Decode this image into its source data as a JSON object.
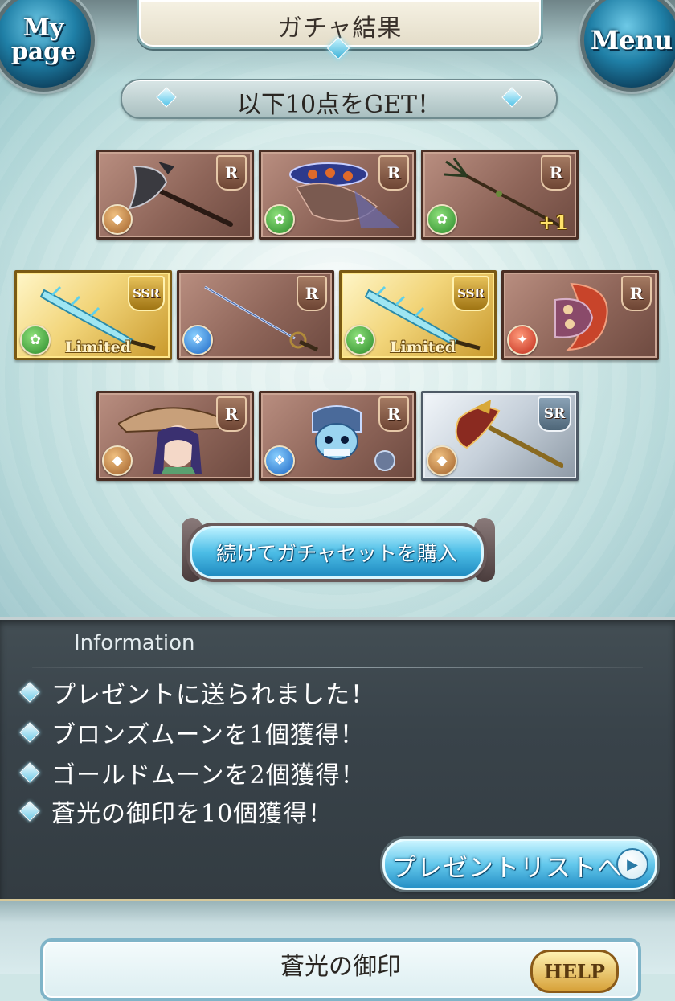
{
  "header": {
    "title": "ガチャ結果",
    "mypage_label": "My\npage",
    "menu_label": "Menu"
  },
  "result_banner": "以下10点をGET！",
  "cards": [
    {
      "rarity": "R",
      "element": "earth",
      "element_icon": "earth-element-icon",
      "art": "axe-weapon",
      "plus": "",
      "limited": ""
    },
    {
      "rarity": "R",
      "element": "wind",
      "element_icon": "wind-element-icon",
      "art": "insect-monster-summon",
      "plus": "",
      "limited": ""
    },
    {
      "rarity": "R",
      "element": "wind",
      "element_icon": "wind-element-icon",
      "art": "trident-spear-weapon",
      "plus": "+1",
      "limited": ""
    },
    {
      "rarity": "SSR",
      "element": "wind",
      "element_icon": "wind-element-icon",
      "art": "crystal-sword-weapon",
      "plus": "",
      "limited": "Limited"
    },
    {
      "rarity": "R",
      "element": "water",
      "element_icon": "water-element-icon",
      "art": "rapier-weapon",
      "plus": "",
      "limited": ""
    },
    {
      "rarity": "SSR",
      "element": "wind",
      "element_icon": "wind-element-icon",
      "art": "crystal-sword-weapon",
      "plus": "",
      "limited": "Limited"
    },
    {
      "rarity": "R",
      "element": "fire",
      "element_icon": "fire-element-icon",
      "art": "knuckle-weapon",
      "plus": "",
      "limited": ""
    },
    {
      "rarity": "R",
      "element": "earth",
      "element_icon": "earth-element-icon",
      "art": "mushroom-girl-summon",
      "plus": "",
      "limited": ""
    },
    {
      "rarity": "R",
      "element": "water",
      "element_icon": "water-element-icon",
      "art": "skeleton-knight-summon",
      "plus": "",
      "limited": ""
    },
    {
      "rarity": "SR",
      "element": "earth",
      "element_icon": "earth-element-icon",
      "art": "golden-axe-weapon",
      "plus": "",
      "limited": ""
    }
  ],
  "buy_button": "続けてガチャセットを購入",
  "information": {
    "title": "Information",
    "lines": [
      "プレゼントに送られました！",
      "ブロンズムーンを1個獲得！",
      "ゴールドムーンを2個獲得！",
      "蒼光の御印を10個獲得！"
    ],
    "present_button": "プレゼントリストへ"
  },
  "seal_section": {
    "title": "蒼光の御印",
    "help_label": "HELP"
  },
  "colors": {
    "accent_blue": "#4cbde6",
    "panel_dark": "#39434a",
    "card_r": "#8e6559",
    "card_ssr": "#f2d57a",
    "card_sr": "#c6d0da"
  }
}
